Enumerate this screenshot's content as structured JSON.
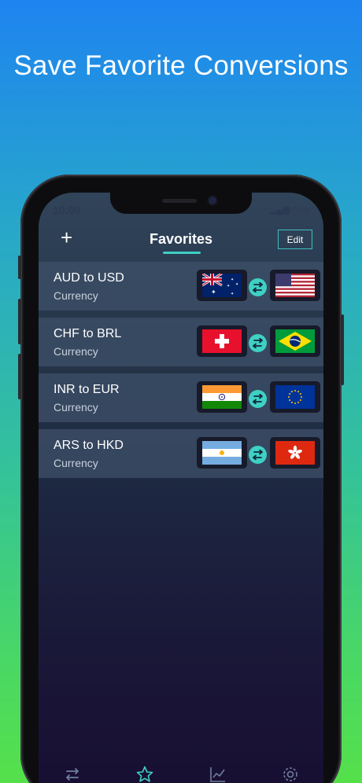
{
  "headline": "Save Favorite Conversions",
  "status_bar": {
    "time": "10:00",
    "icons": "▂▄▆ ◠ ▭"
  },
  "nav": {
    "title": "Favorites",
    "add_label": "+",
    "edit_label": "Edit"
  },
  "favorites": [
    {
      "title": "AUD to USD",
      "subtitle": "Currency",
      "from_flag": "australia-flag",
      "to_flag": "usa-flag"
    },
    {
      "title": "CHF to BRL",
      "subtitle": "Currency",
      "from_flag": "switzerland-flag",
      "to_flag": "brazil-flag"
    },
    {
      "title": "INR to EUR",
      "subtitle": "Currency",
      "from_flag": "india-flag",
      "to_flag": "eu-flag"
    },
    {
      "title": "ARS to HKD",
      "subtitle": "Currency",
      "from_flag": "argentina-flag",
      "to_flag": "hong-kong-flag"
    }
  ],
  "tabbar": {
    "icons": [
      "convert-icon",
      "star-icon",
      "chart-icon",
      "gear-icon"
    ],
    "active_color": "#3fd0c4"
  },
  "colors": {
    "accent": "#3fd0c4"
  }
}
